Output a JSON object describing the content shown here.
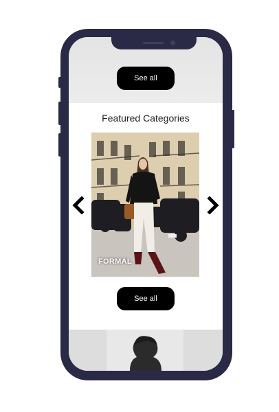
{
  "top_section": {
    "see_all_label": "See all"
  },
  "featured": {
    "title": "Featured Categories",
    "current_category": "FORMAL",
    "see_all_label": "See all"
  },
  "icons": {
    "prev": "chevron-left-icon",
    "next": "chevron-right-icon",
    "avatar": "user-silhouette-icon"
  },
  "colors": {
    "phone_frame": "#2a2a47",
    "button_bg": "#000000",
    "button_text": "#ffffff"
  }
}
